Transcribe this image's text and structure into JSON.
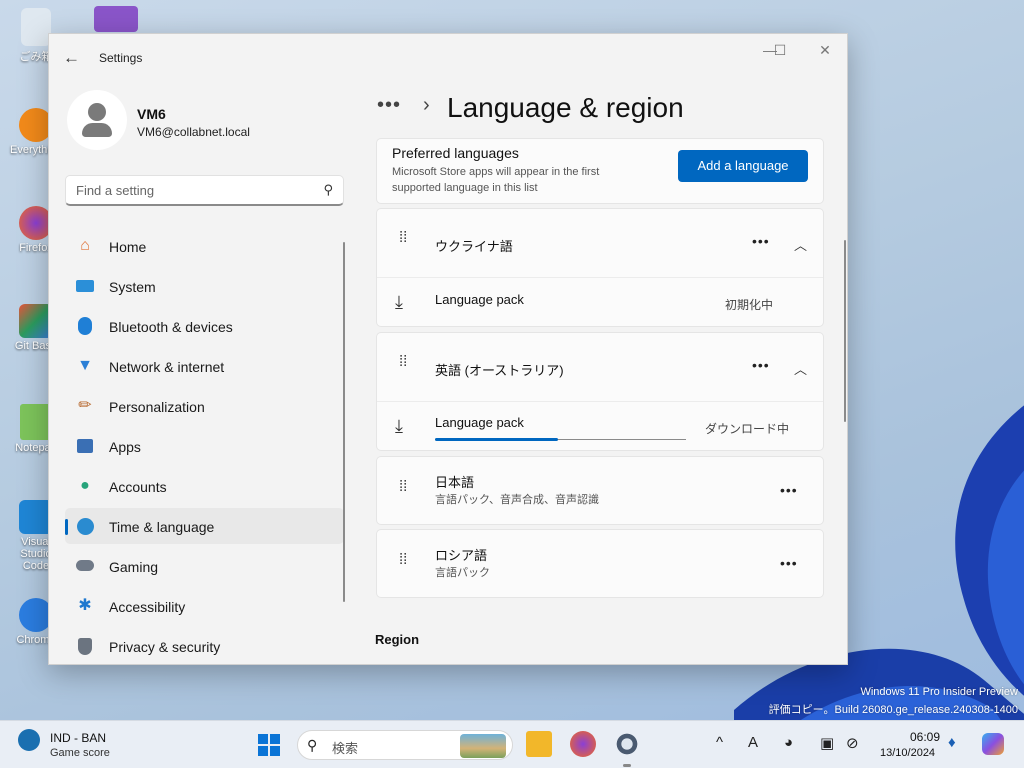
{
  "desktop": {
    "icons": [
      "ごみ箱",
      "Everything",
      "Firefox",
      "Git Bash",
      "Notepad",
      "Visual Studio Code",
      "Chrome"
    ],
    "watermark_line1": "Windows 11 Pro Insider Preview",
    "watermark_line2": "評価コピー。Build 26080.ge_release.240308-1400"
  },
  "window": {
    "title": "Settings",
    "back_glyph": "←",
    "minimize_glyph": "—",
    "maximize_glyph": "☐",
    "close_glyph": "✕"
  },
  "user": {
    "name": "VM6",
    "email": "VM6@collabnet.local"
  },
  "search": {
    "placeholder": "Find a setting",
    "icon": "search-icon"
  },
  "sidebar": {
    "items": [
      {
        "label": "Home",
        "icon": "home-icon",
        "color": "#e0743a"
      },
      {
        "label": "System",
        "icon": "system-icon",
        "color": "#2b8fd8"
      },
      {
        "label": "Bluetooth & devices",
        "icon": "bluetooth-icon",
        "color": "#1f7fd6"
      },
      {
        "label": "Network & internet",
        "icon": "wifi-icon",
        "color": "#2a7fd6"
      },
      {
        "label": "Personalization",
        "icon": "brush-icon",
        "color": "#b86a30"
      },
      {
        "label": "Apps",
        "icon": "apps-icon",
        "color": "#3a6fb4"
      },
      {
        "label": "Accounts",
        "icon": "accounts-icon",
        "color": "#26a37a"
      },
      {
        "label": "Time & language",
        "icon": "globe-clock-icon",
        "color": "#2a8bd0"
      },
      {
        "label": "Gaming",
        "icon": "gamepad-icon",
        "color": "#707a88"
      },
      {
        "label": "Accessibility",
        "icon": "accessibility-icon",
        "color": "#1e78cf"
      },
      {
        "label": "Privacy & security",
        "icon": "shield-icon",
        "color": "#6b7480"
      }
    ],
    "active_index": 7
  },
  "main": {
    "breadcrumb_dots": "•••",
    "breadcrumb_chevron": "›",
    "title": "Language & region",
    "preferred": {
      "title": "Preferred languages",
      "subtitle": "Microsoft Store apps will appear in the first supported language in this list",
      "add_button": "Add a language"
    },
    "languages": [
      {
        "name": "ウクライナ語",
        "expanded": true,
        "pack_label": "Language pack",
        "pack_status": "初期化中"
      },
      {
        "name": "英語 (オーストラリア)",
        "expanded": true,
        "pack_label": "Language pack",
        "pack_status": "ダウンロード中",
        "progress": 0.49
      },
      {
        "name": "日本語",
        "features": "言語パック、音声合成、音声認識"
      },
      {
        "name": "ロシア語",
        "features": "言語パック"
      }
    ],
    "region_heading": "Region"
  },
  "taskbar": {
    "weather_line1": "IND - BAN",
    "weather_line2": "Game score",
    "search_text": "検索",
    "time": "06:09",
    "date": "13/10/2024",
    "accent": "#0a74d6"
  }
}
